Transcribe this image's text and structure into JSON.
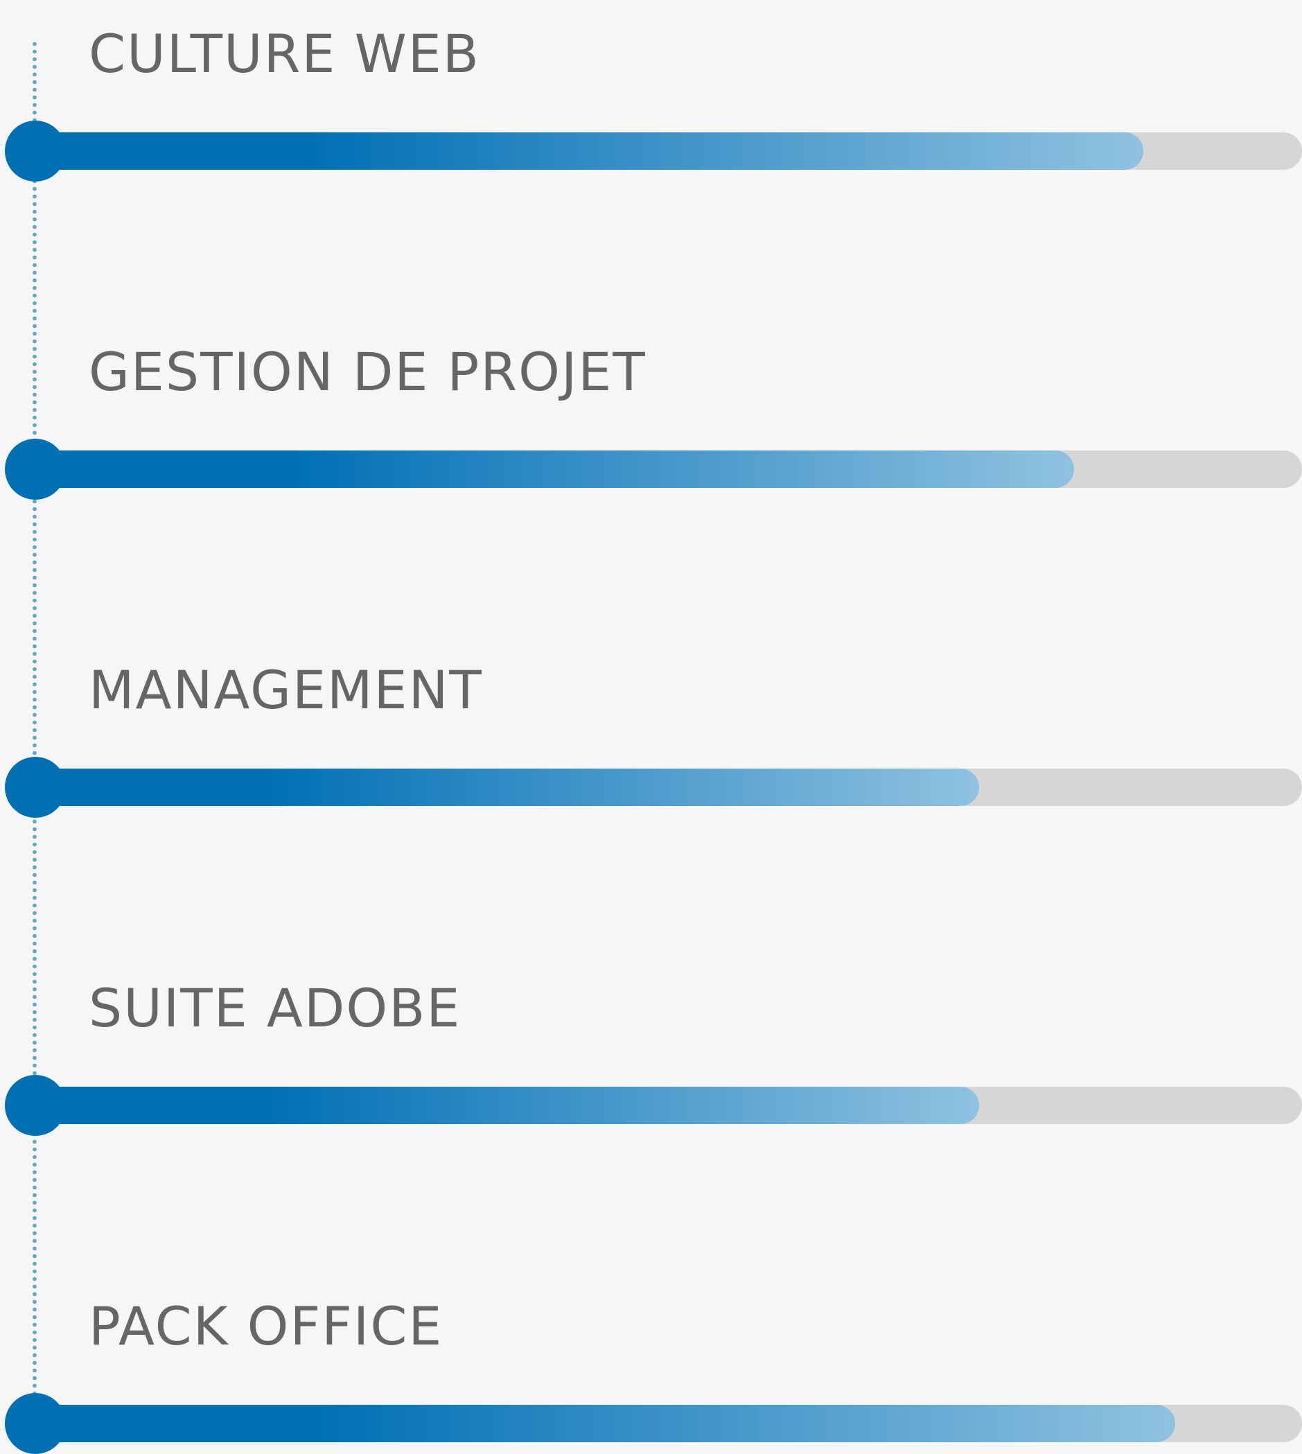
{
  "colors": {
    "background": "#f6f6f6",
    "label": "#666666",
    "accent": "#0070b5",
    "track": "#d6d6d6",
    "timeline": "#5aa9c9"
  },
  "skills": [
    {
      "label": "CULTURE WEB",
      "level": 0.875
    },
    {
      "label": "GESTION DE PROJET",
      "level": 0.82
    },
    {
      "label": "MANAGEMENT",
      "level": 0.745
    },
    {
      "label": "SUITE ADOBE",
      "level": 0.745
    },
    {
      "label": "PACK OFFICE",
      "level": 0.9
    }
  ]
}
